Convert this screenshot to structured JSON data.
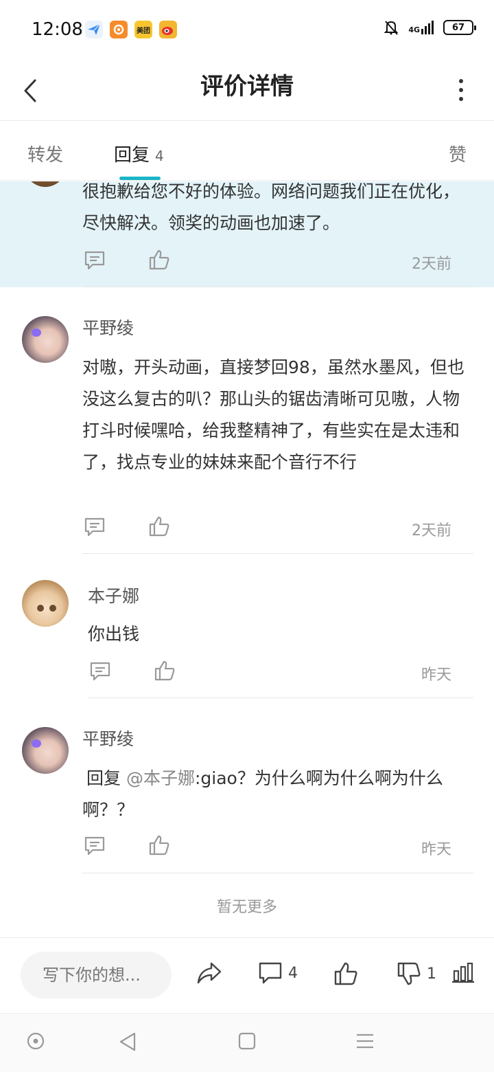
{
  "status_bar": {
    "time": "12:08",
    "apps": [
      {
        "icon": "paper-plane-app-icon",
        "color": "#5aa6f5"
      },
      {
        "icon": "uc-browser-app-icon",
        "color": "#f68b2a"
      },
      {
        "icon": "meituan-app-icon",
        "color": "#f7c62f",
        "label": "美团"
      },
      {
        "icon": "weibo-app-icon",
        "color": "#f2b630"
      }
    ],
    "network": "4G",
    "battery": "67"
  },
  "header": {
    "title": "评价详情"
  },
  "tabs": {
    "forward": "转发",
    "reply": "回复",
    "reply_count": "4",
    "like": "赞",
    "accent": "#1ab5c6"
  },
  "comments": [
    {
      "text": "很抱歉给您不好的体验。网络问题我们正在优化，尽快解决。领奖的动画也加速了。",
      "time": "2天前"
    },
    {
      "user": "平野绫",
      "text": "对嗷，开头动画，直接梦回98，虽然水墨风，但也没这么复古的叭？那山头的锯齿清晰可见嗷，人物打斗时候嘿哈，给我整精神了，有些实在是太违和了，找点专业的妹妹来配个音行不行",
      "time": "2天前"
    },
    {
      "user": "本子娜",
      "text": "你出钱",
      "time": "昨天"
    },
    {
      "user": "平野绫",
      "reply_prefix": "回复",
      "mention": "@本子娜",
      "text": ":giao？为什么啊为什么啊为什么啊？？",
      "time": "昨天"
    }
  ],
  "no_more": "暂无更多",
  "bottom_bar": {
    "placeholder": "写下你的想...",
    "comment_count": "4",
    "dislike_count": "1"
  }
}
